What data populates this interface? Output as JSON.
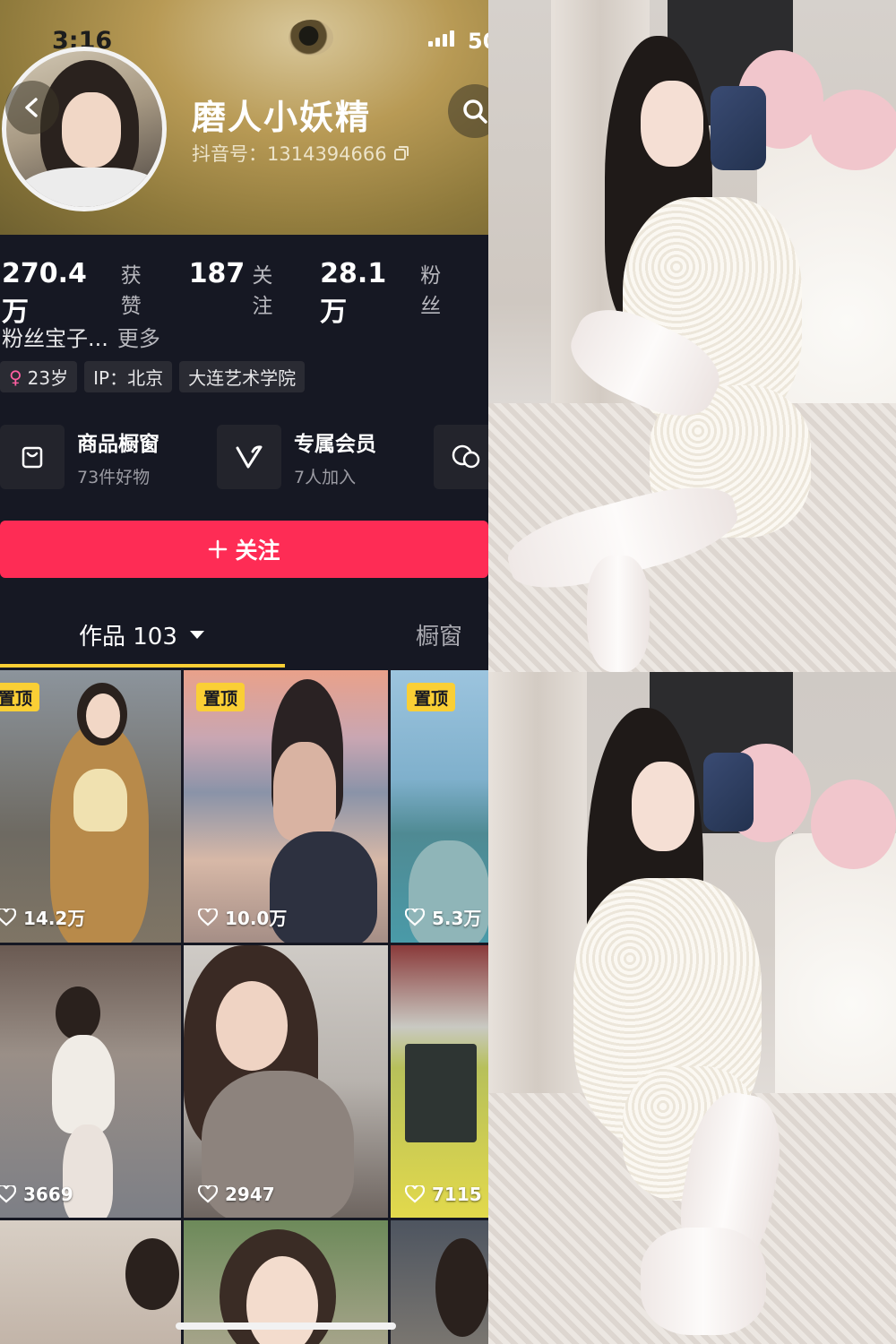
{
  "status_bar": {
    "time": "3:16",
    "battery": "50"
  },
  "profile": {
    "nickname": "磨人小妖精",
    "douyin_id": "抖音号：1314394666"
  },
  "stats": [
    {
      "value": "270.4万",
      "label": "获赞"
    },
    {
      "value": "187",
      "label": "关注"
    },
    {
      "value": "28.1万",
      "label": "粉丝"
    }
  ],
  "bio": {
    "text": "粉丝宝子...",
    "more": "更多"
  },
  "tags": {
    "age": "23岁",
    "ip": "IP：北京",
    "school": "大连艺术学院"
  },
  "features": [
    {
      "title": "商品橱窗",
      "subtitle": "73件好物",
      "icon": "bag-icon"
    },
    {
      "title": "专属会员",
      "subtitle": "7人加入",
      "icon": "vip-v-icon"
    },
    {
      "title": "",
      "subtitle": "",
      "icon": "chat-icon"
    }
  ],
  "follow_button": {
    "label": "关注"
  },
  "tabs": {
    "works": "作品 103",
    "shop": "橱窗"
  },
  "pin_label": "置顶",
  "videos": [
    {
      "likes": "14.2万",
      "pinned": true
    },
    {
      "likes": "10.0万",
      "pinned": true
    },
    {
      "likes": "5.3万",
      "pinned": true
    },
    {
      "likes": "3669",
      "pinned": false
    },
    {
      "likes": "2947",
      "pinned": false
    },
    {
      "likes": "7115",
      "pinned": false
    }
  ],
  "colors": {
    "accent": "#fe2c55",
    "pin": "#facf35",
    "background": "#161823"
  }
}
